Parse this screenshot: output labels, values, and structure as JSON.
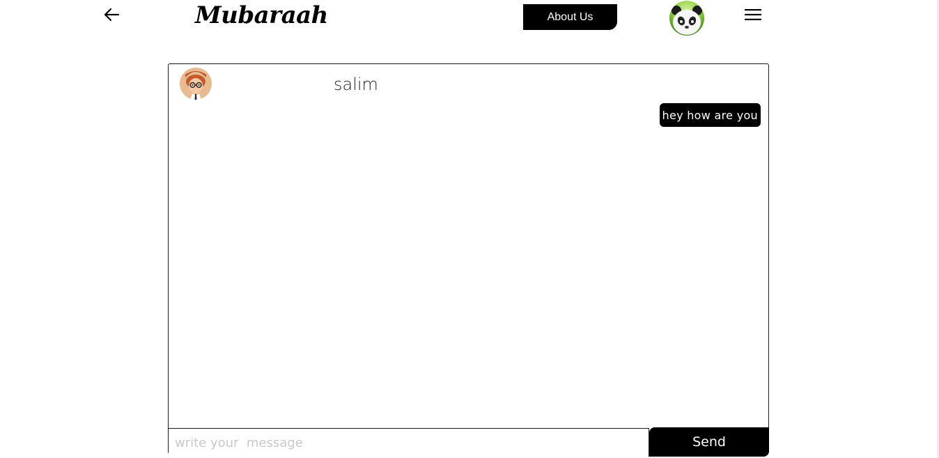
{
  "header": {
    "back_icon": "arrow-left-icon",
    "brand": "Mubaraah",
    "about_label": "About Us",
    "profile_avatar": "panda-avatar",
    "menu_icon": "hamburger-menu-icon"
  },
  "chat": {
    "contact_name": "salim",
    "contact_avatar": "cartoon-boy-avatar",
    "messages": [
      {
        "text": "hey how are you",
        "direction": "outgoing"
      }
    ],
    "input_placeholder": "write your  message",
    "input_value": "",
    "send_label": "Send"
  },
  "colors": {
    "accent": "#000000",
    "background": "#ffffff",
    "placeholder": "#c8c8c8"
  }
}
